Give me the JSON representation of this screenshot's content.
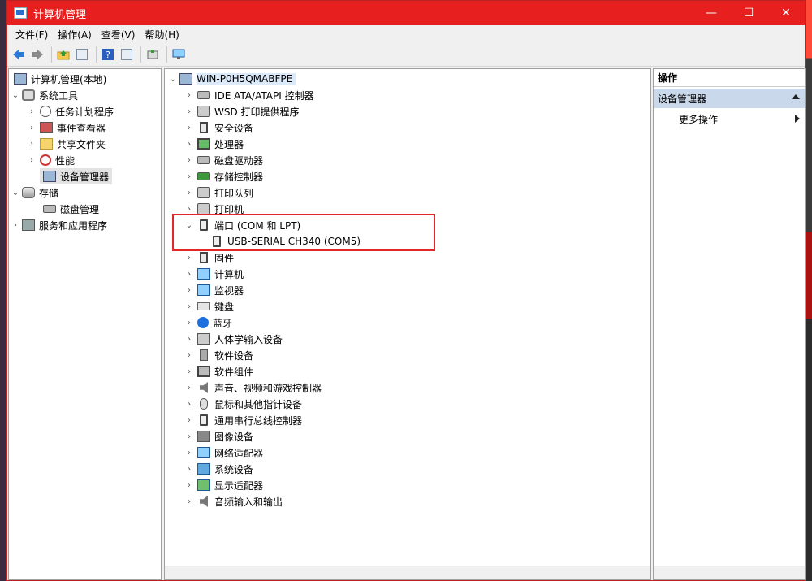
{
  "window": {
    "title": "计算机管理",
    "controls": {
      "minimize": "—",
      "maximize": "☐",
      "close": "✕"
    }
  },
  "menu": [
    {
      "label": "文件(F)"
    },
    {
      "label": "操作(A)"
    },
    {
      "label": "查看(V)"
    },
    {
      "label": "帮助(H)"
    }
  ],
  "left_tree": {
    "root": "计算机管理(本地)",
    "system_tools": "系统工具",
    "task_scheduler": "任务计划程序",
    "event_viewer": "事件查看器",
    "shared_folders": "共享文件夹",
    "performance": "性能",
    "device_manager": "设备管理器",
    "storage": "存储",
    "disk_management": "磁盘管理",
    "services_apps": "服务和应用程序"
  },
  "device_tree": {
    "root": "WIN-P0H5QMABFPE",
    "categories": [
      {
        "label": "IDE ATA/ATAPI 控制器"
      },
      {
        "label": "WSD 打印提供程序"
      },
      {
        "label": "安全设备"
      },
      {
        "label": "处理器"
      },
      {
        "label": "磁盘驱动器"
      },
      {
        "label": "存储控制器"
      },
      {
        "label": "打印队列"
      },
      {
        "label": "打印机"
      },
      {
        "label": "端口 (COM 和 LPT)"
      },
      {
        "label": "USB-SERIAL CH340 (COM5)"
      },
      {
        "label": "固件"
      },
      {
        "label": "计算机"
      },
      {
        "label": "监视器"
      },
      {
        "label": "键盘"
      },
      {
        "label": "蓝牙"
      },
      {
        "label": "人体学输入设备"
      },
      {
        "label": "软件设备"
      },
      {
        "label": "软件组件"
      },
      {
        "label": "声音、视频和游戏控制器"
      },
      {
        "label": "鼠标和其他指针设备"
      },
      {
        "label": "通用串行总线控制器"
      },
      {
        "label": "图像设备"
      },
      {
        "label": "网络适配器"
      },
      {
        "label": "系统设备"
      },
      {
        "label": "显示适配器"
      },
      {
        "label": "音频输入和输出"
      }
    ]
  },
  "actions": {
    "header": "操作",
    "section": "设备管理器",
    "more": "更多操作"
  },
  "colors": {
    "titlebar": "#e81f1f",
    "highlight": "#e3262a",
    "section_bg": "#c9d8ea"
  }
}
